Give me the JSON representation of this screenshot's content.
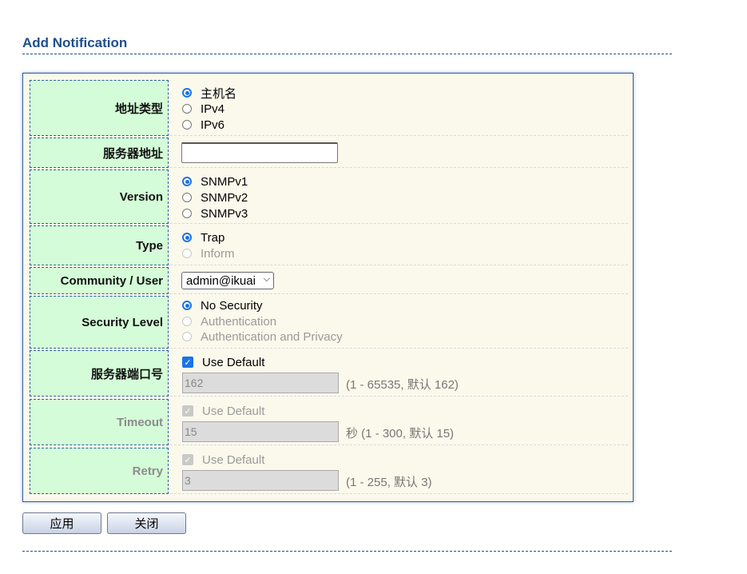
{
  "page_title": "Add Notification",
  "rows": {
    "address_type": {
      "label": "地址类型",
      "options": [
        "主机名",
        "IPv4",
        "IPv6"
      ]
    },
    "server_address": {
      "label": "服务器地址",
      "value": ""
    },
    "version": {
      "label": "Version",
      "options": [
        "SNMPv1",
        "SNMPv2",
        "SNMPv3"
      ]
    },
    "type": {
      "label": "Type",
      "options": [
        "Trap",
        "Inform"
      ]
    },
    "community": {
      "label": "Community / User",
      "selected": "admin@ikuai"
    },
    "security_level": {
      "label": "Security Level",
      "options": [
        "No Security",
        "Authentication",
        "Authentication and Privacy"
      ]
    },
    "server_port": {
      "label": "服务器端口号",
      "use_default": "Use Default",
      "value": "162",
      "hint": "(1 - 65535, 默认 162)"
    },
    "timeout": {
      "label": "Timeout",
      "use_default": "Use Default",
      "value": "15",
      "hint": "秒 (1 - 300, 默认 15)"
    },
    "retry": {
      "label": "Retry",
      "use_default": "Use Default",
      "value": "3",
      "hint": "(1 - 255, 默认 3)"
    }
  },
  "buttons": {
    "apply": "应用",
    "close": "关闭"
  },
  "colors": {
    "title": "#1f4e8c",
    "label_bg": "#d5fcd8",
    "panel_bg": "#fbf9ec",
    "accent": "#1a73e8"
  }
}
